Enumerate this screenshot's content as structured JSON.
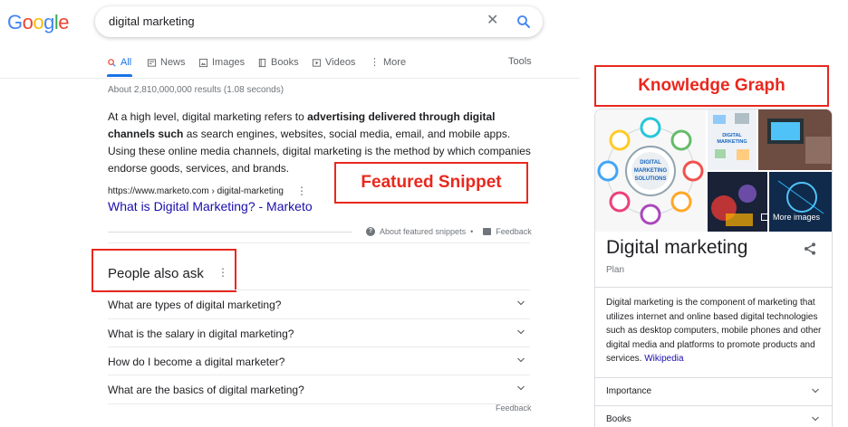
{
  "logo": {
    "letters": [
      {
        "ch": "G",
        "color": "#4285f4"
      },
      {
        "ch": "o",
        "color": "#ea4335"
      },
      {
        "ch": "o",
        "color": "#fbbc05"
      },
      {
        "ch": "g",
        "color": "#4285f4"
      },
      {
        "ch": "l",
        "color": "#34a853"
      },
      {
        "ch": "e",
        "color": "#ea4335"
      }
    ]
  },
  "search": {
    "query": "digital marketing",
    "clear_icon": "close-icon",
    "submit_icon": "search-icon"
  },
  "tabs": [
    {
      "label": "All",
      "icon": "search-icon",
      "active": true
    },
    {
      "label": "News",
      "icon": "news-icon"
    },
    {
      "label": "Images",
      "icon": "image-icon"
    },
    {
      "label": "Books",
      "icon": "book-icon"
    },
    {
      "label": "Videos",
      "icon": "play-icon"
    },
    {
      "label": "More",
      "icon": "more-vert-icon"
    }
  ],
  "tools_label": "Tools",
  "stats": "About 2,810,000,000 results (1.08 seconds)",
  "featured_snippet": {
    "text_parts": [
      {
        "text": "At a high level, digital marketing refers to ",
        "bold": false
      },
      {
        "text": "advertising delivered through digital channels such",
        "bold": true
      },
      {
        "text": " as search engines, websites, social media, email, and mobile apps. Using these online media channels, digital marketing is the method by which companies endorse goods, services, and brands.",
        "bold": false
      }
    ],
    "url": "https://www.marketo.com › digital-marketing",
    "title": "What is Digital Marketing? - Marketo",
    "about_label": "About featured snippets",
    "feedback_label": "Feedback"
  },
  "annotations": {
    "featured_snippet": "Featured Snippet",
    "knowledge_graph": "Knowledge Graph"
  },
  "people_also_ask": {
    "title": "People also ask",
    "questions": [
      "What are types of digital marketing?",
      "What is the salary in digital marketing?",
      "How do I become a digital marketer?",
      "What are the basics of digital marketing?"
    ],
    "feedback_label": "Feedback"
  },
  "knowledge_panel": {
    "title": "Digital marketing",
    "subtitle": "Plan",
    "description": "Digital marketing is the component of marketing that utilizes internet and online based digital technologies such as desktop computers, mobile phones and other digital media and platforms to promote products and services.",
    "source_link": "Wikipedia",
    "more_images_label": "More images",
    "image_texts": {
      "main": [
        "DIGITAL",
        "MARKETING",
        "SOLUTIONS"
      ],
      "side": [
        "DIGITAL",
        "MARKETING"
      ]
    },
    "rows": [
      "Importance",
      "Books"
    ]
  }
}
